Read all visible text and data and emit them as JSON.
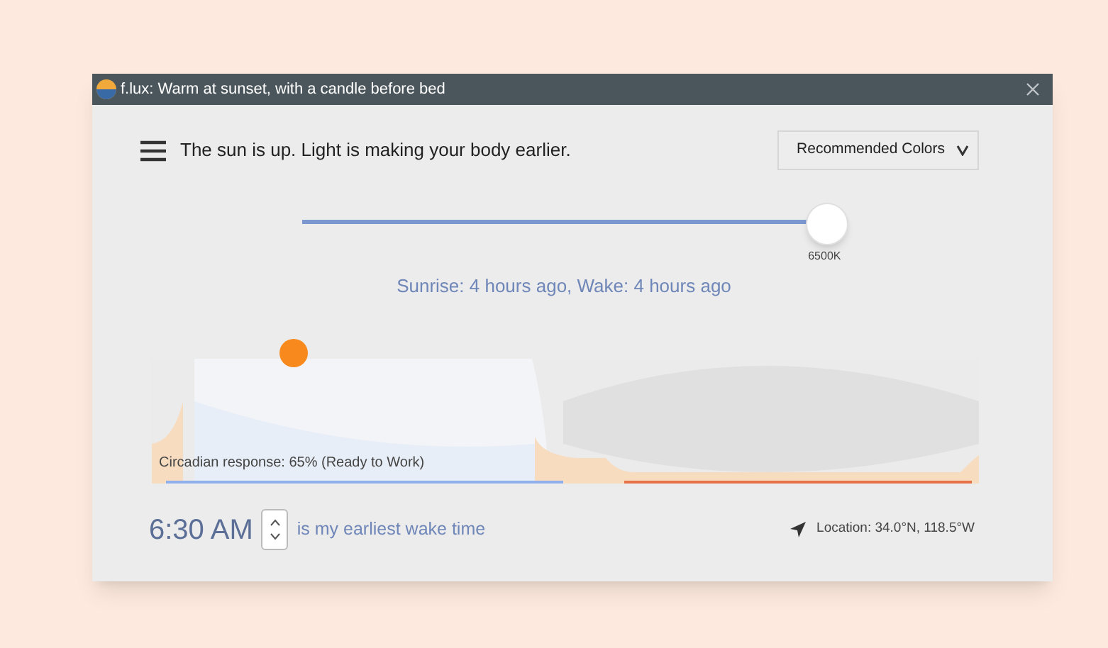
{
  "window": {
    "title": "f.lux: Warm at sunset, with a candle before bed"
  },
  "status": "The sun is up. Light is making your body earlier.",
  "color_menu": {
    "label": "Recommended Colors"
  },
  "temperature": {
    "level": 0.96,
    "reading": "6500K"
  },
  "sun_info": "Sunrise: 4 hours ago, Wake: 4 hours ago",
  "graph": {
    "caption": "Circadian response: 65% (Ready to Work)"
  },
  "wake": {
    "time": "6:30 AM",
    "label": "is my earliest wake time"
  },
  "location": "Location: 34.0°N, 118.5°W"
}
